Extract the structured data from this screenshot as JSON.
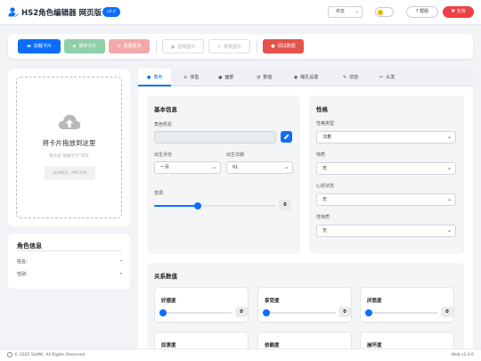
{
  "header": {
    "title": "HS2角色编辑器 网页版",
    "version": "v2.0",
    "language": "中文",
    "help_label": "帮助",
    "support_label": "支持"
  },
  "toolbar": {
    "load_label": "加载卡片",
    "save_label": "保存卡片",
    "reset_label": "重置更改",
    "replace_label": "替换图片",
    "restore_label": "恢复图片",
    "debug_label": "调试数据"
  },
  "upload": {
    "title": "将卡片拖放到这里",
    "subtitle": "或点击\"加载卡片\"浏览",
    "formats": "支持格式：PNG文件"
  },
  "char_info": {
    "title": "角色信息",
    "rows": [
      {
        "label": "姓名:",
        "value": "-"
      },
      {
        "label": "性别:",
        "value": "-"
      }
    ]
  },
  "tabs": [
    {
      "label": "角色",
      "icon": "user-icon"
    },
    {
      "label": "体型",
      "icon": "body-icon"
    },
    {
      "label": "面部",
      "icon": "palette-icon"
    },
    {
      "label": "数值",
      "icon": "chart-pie-icon"
    },
    {
      "label": "瞳孔设置",
      "icon": "eye-icon"
    },
    {
      "label": "妆容",
      "icon": "brush-icon"
    },
    {
      "label": "头发",
      "icon": "scissors-icon"
    }
  ],
  "basic_info": {
    "title": "基本信息",
    "name_label": "角色姓名",
    "name_value": "",
    "birth_month_label": "出生月份",
    "birth_month_value": "一月",
    "birth_day_label": "出生日期",
    "birth_day_value": "01",
    "pitch_label": "音调",
    "pitch_value": "0",
    "pitch_fraction": 0.36
  },
  "personality": {
    "title": "性格",
    "fields": [
      {
        "label": "性格类型",
        "value": "沉着"
      },
      {
        "label": "特质",
        "value": "无"
      },
      {
        "label": "心愿状态",
        "value": "无"
      },
      {
        "label": "性特质",
        "value": "无"
      }
    ]
  },
  "relations": {
    "title": "关系数值",
    "items": [
      {
        "label": "好感度",
        "value": "0",
        "fraction": 0
      },
      {
        "label": "享受度",
        "value": "0",
        "fraction": 0
      },
      {
        "label": "厌恶度",
        "value": "0",
        "fraction": 0
      },
      {
        "label": "奴隶度",
        "value": "",
        "fraction": 0
      },
      {
        "label": "依赖度",
        "value": "",
        "fraction": 0
      },
      {
        "label": "崩坏度",
        "value": "",
        "fraction": 0
      }
    ]
  },
  "footer": {
    "copyright": "© 2025 SlotMi. All Rights Reserved.",
    "version": "Web v2.0.0"
  },
  "colors": {
    "primary": "#0d6efd",
    "success_light": "#8fd0a8",
    "danger_light": "#f2a9a9",
    "danger": "#e5534b",
    "support": "#ef3f42"
  }
}
